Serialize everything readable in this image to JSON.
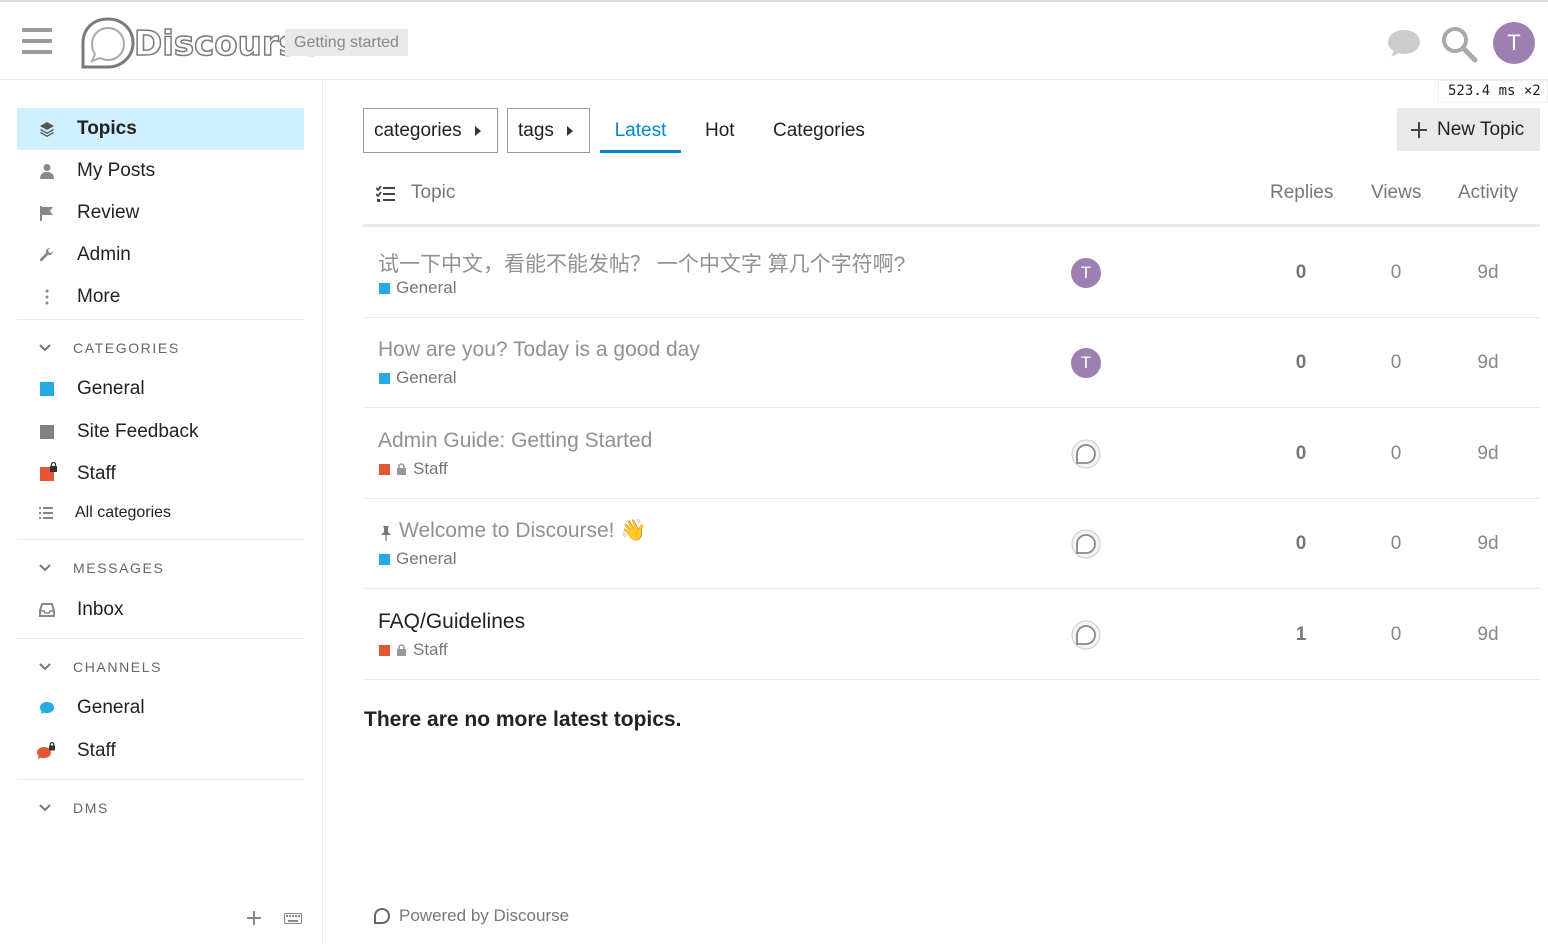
{
  "header": {
    "logo_text": "Discourse",
    "getting_started": "Getting started",
    "avatar_letter": "T",
    "timing": "523.4 ms ×2"
  },
  "sidebar": {
    "items": [
      {
        "label": "Topics",
        "icon": "layers-icon"
      },
      {
        "label": "My Posts",
        "icon": "user-icon"
      },
      {
        "label": "Review",
        "icon": "flag-icon"
      },
      {
        "label": "Admin",
        "icon": "wrench-icon"
      },
      {
        "label": "More",
        "icon": "ellipsis-vertical-icon"
      }
    ],
    "categories_header": "CATEGORIES",
    "categories": [
      {
        "label": "General",
        "color": "#25aae1"
      },
      {
        "label": "Site Feedback",
        "color": "#808281"
      },
      {
        "label": "Staff",
        "color": "#e45735"
      }
    ],
    "all_categories": "All categories",
    "messages_header": "MESSAGES",
    "inbox": "Inbox",
    "channels_header": "CHANNELS",
    "channels": [
      {
        "label": "General",
        "color": "#25aae1"
      },
      {
        "label": "Staff",
        "color": "#e45735"
      }
    ],
    "dms_header": "DMS"
  },
  "nav": {
    "categories_dropdown": "categories",
    "tags_dropdown": "tags",
    "tabs": [
      "Latest",
      "Hot",
      "Categories"
    ],
    "new_topic": "New Topic"
  },
  "table": {
    "headers": {
      "topic": "Topic",
      "replies": "Replies",
      "views": "Views",
      "activity": "Activity"
    },
    "rows": [
      {
        "title": "试一下中文，看能不能发帖？ 一个中文字 算几个字符啊?",
        "category": "General",
        "category_color": "#25aae1",
        "locked": false,
        "poster": "T",
        "replies": "0",
        "views": "0",
        "activity": "9d"
      },
      {
        "title": "How are you? Today is a good day",
        "category": "General",
        "category_color": "#25aae1",
        "locked": false,
        "poster": "T",
        "replies": "0",
        "views": "0",
        "activity": "9d"
      },
      {
        "title": "Admin Guide: Getting Started",
        "category": "Staff",
        "category_color": "#e45735",
        "locked": true,
        "poster": "system",
        "replies": "0",
        "views": "0",
        "activity": "9d"
      },
      {
        "title": "Welcome to Discourse! 👋",
        "category": "General",
        "category_color": "#25aae1",
        "locked": false,
        "pinned": true,
        "poster": "system",
        "replies": "0",
        "views": "0",
        "activity": "9d"
      },
      {
        "title": "FAQ/Guidelines",
        "category": "Staff",
        "category_color": "#e45735",
        "locked": true,
        "poster": "system",
        "replies": "1",
        "views": "0",
        "activity": "9d"
      }
    ]
  },
  "no_more": "There are no more latest topics.",
  "powered_by": "Powered by Discourse"
}
